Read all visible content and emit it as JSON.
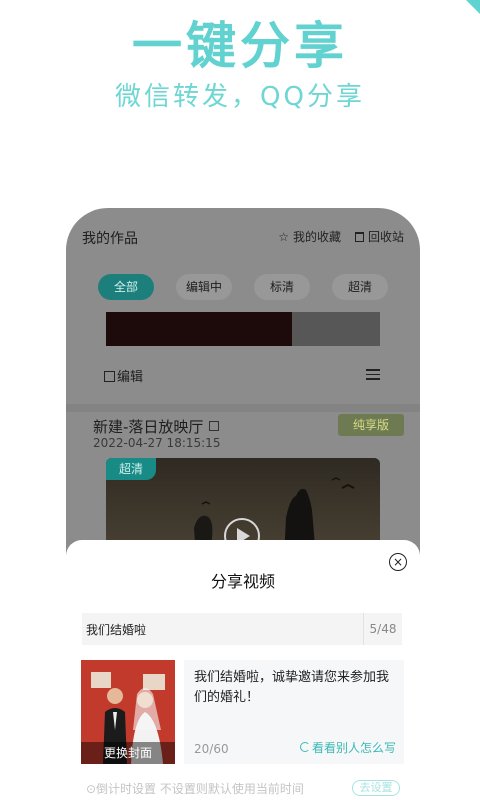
{
  "hero": {
    "title": "一键分享",
    "subtitle": "微信转发，QQ分享"
  },
  "app": {
    "page_title": "我的作品",
    "favorites_label": "我的收藏",
    "recycle_label": "回收站",
    "tabs": [
      "全部",
      "编辑中",
      "标清",
      "超清"
    ],
    "active_tab": 0,
    "edit_label": "编辑",
    "work": {
      "title": "新建-落日放映厅",
      "date": "2022-04-27 18:15:15",
      "badge": "纯享版",
      "quality_badge": "超清"
    }
  },
  "share_sheet": {
    "title": "分享视频",
    "video_title": "我们结婚啦",
    "title_count": "5/48",
    "cover_button": "更换封面",
    "description": "我们结婚啦，诚挚邀请您来参加我们的婚礼！",
    "desc_count": "20/60",
    "see_others": "看看别人怎么写",
    "cut_row_left": "⊙倒计时设置  不设置则默认使用当前时间",
    "cut_row_right": "去设置"
  },
  "colors": {
    "accent": "#62d2d0",
    "overlay": "#8c8c8c",
    "active_tab": "#1c7f7c"
  }
}
